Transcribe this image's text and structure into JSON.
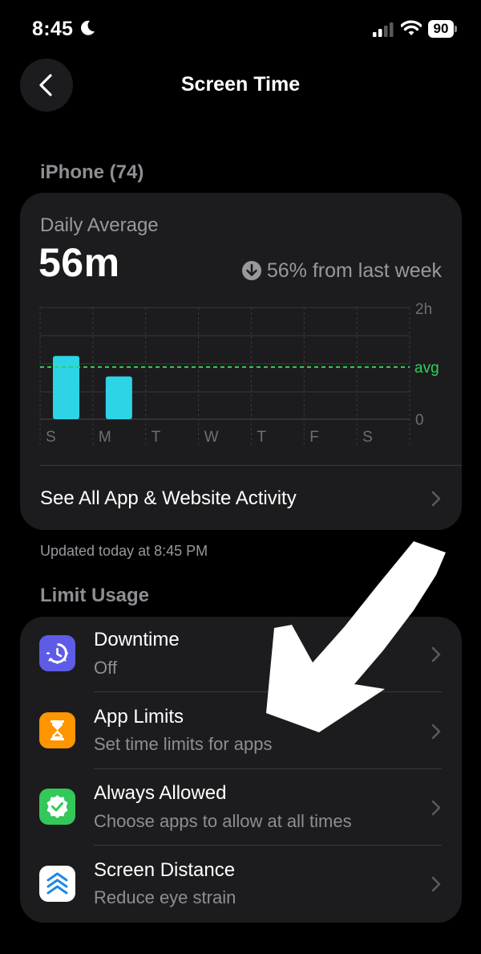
{
  "status_bar": {
    "time": "8:45",
    "battery": "90"
  },
  "nav": {
    "title": "Screen Time"
  },
  "device_header": "iPhone (74)",
  "summary": {
    "label": "Daily Average",
    "value": "56m",
    "change": "56% from last week"
  },
  "chart_data": {
    "type": "bar",
    "categories": [
      "S",
      "M",
      "T",
      "W",
      "T",
      "F",
      "S"
    ],
    "values": [
      68,
      46,
      0,
      0,
      0,
      0,
      0
    ],
    "unit": "minutes",
    "y_tick_labels": [
      "2h",
      "0"
    ],
    "ylim": [
      0,
      120
    ],
    "average_label": "avg",
    "average_value": 56,
    "bar_color": "#2dd4e6",
    "average_line_color": "#30d158"
  },
  "see_all": {
    "label": "See All App & Website Activity"
  },
  "updated": "Updated today at 8:45 PM",
  "limit_header": "Limit Usage",
  "limit_rows": [
    {
      "title": "Downtime",
      "subtitle": "Off",
      "icon": "downtime-icon",
      "color": "#5e5ce6"
    },
    {
      "title": "App Limits",
      "subtitle": "Set time limits for apps",
      "icon": "hourglass-icon",
      "color": "#ff9500"
    },
    {
      "title": "Always Allowed",
      "subtitle": "Choose apps to allow at all times",
      "icon": "checkmark-badge-icon",
      "color": "#34c759"
    },
    {
      "title": "Screen Distance",
      "subtitle": "Reduce eye strain",
      "icon": "screen-distance-icon",
      "color": "#ffffff"
    }
  ]
}
